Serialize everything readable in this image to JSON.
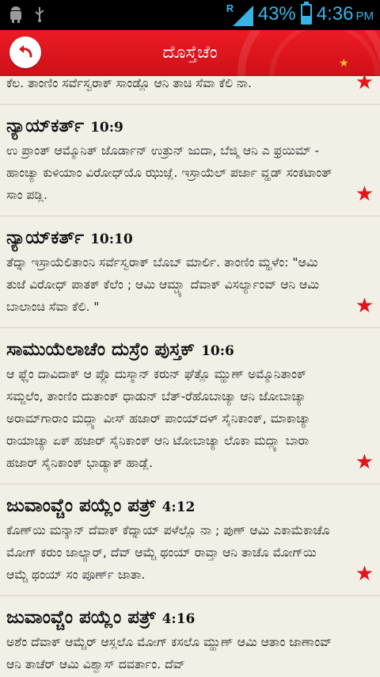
{
  "status_bar": {
    "icons": [
      "android-icon",
      "usb-icon"
    ],
    "network_type": "R",
    "battery_percent": "43%",
    "battery_level": 0.43,
    "time": "4:36",
    "time_suffix": "PM",
    "colors": {
      "background": "#000000",
      "accent": "#36b5e5"
    }
  },
  "app_bar": {
    "title": "ದೊಸ್ತೆಚೆಂ",
    "back_icon": "back-arrow-icon",
    "colors": {
      "background": "#e31b23",
      "text": "#ffffff"
    }
  },
  "verses": [
    {
      "book": "",
      "ref": "",
      "text": "ಕೆಲ. ತಾಂಣಿಂ ಸರ್ವೆಸ್ವರಾಕ್ ಸಾಂಡ್ಲೊ ಆನಿ ತಾಚಿ ಸೆವಾ ಕೆಲಿ ನಾ.",
      "starred": true
    },
    {
      "book": "ನ್ಯಾಯ್‌ಕರ್ತ್",
      "ref": "10:9",
      "text": "ಉ ಪ್ರಾಂತ್ ಆಮ್ಮೊನಿತ್ ಜೊರ್ಡಾನ್ ಉತ್ರುನ್ ಜುದಾ, ಬೆಜ್ಮಿ ಆನಿ ಎ ಫ್ರಯಿಮ್ - ಹಾಂಚ್ಯಾ ಕುಳಿಯಾಂ ವಿರೋಧ್‌ಯೊ ಝುಜ್ಲೆ. ಇಸ್ರಾಯೆಲ್ ಪರ್ಜಾ ವ್ಹಡ್ ಸಂಕಟಾಂತ್ ಸಾಂ ಪಡ್ಲಿ.",
      "starred": true
    },
    {
      "book": "ನ್ಯಾಯ್‌ಕರ್ತ್",
      "ref": "10:10",
      "text": "ತೆದ್ನಾ ಇಸ್ರಾಯೆಲಿತಾಂನಿ ಸರ್ವೆಸ್ವರಾಕ್ ಬೊಬ್ ಮಾರ್ಲಿ. ತಾಂಣಿಂ ಮ್ಹಳೆಂ: \"ಆಮಿ ತುಜೆ ವಿರೋಧ್ ಪಾತಕ್ ಕೆಲೆಂ ; ಆಮಿ ಆಮ್ಚ್ಯಾ ದೆವಾಕ್ ವಿಸರ್ಲ್ಯಾಂವ್ ಆನಿ ಆಮಿ ಬಾಲಾಂಚಿ ಸೆವಾ ಕೆಲಿ. \"",
      "starred": true
    },
    {
      "book": "ಸಾಮುಯೆಲಾಚೆಂ ದುಸ್ರೆಂ ಪುಸ್ತಕ್",
      "ref": "10:6",
      "text": "ಆ ಫ್ಣೆಂ ದಾವಿದಾಕ್ ಆ ಪ್ಲೊ ದುಸ್ಮಾನ್ ಕರುನ್ ಘೆತ್ಲೊ ಮ್ಹುಣ್ ಅಮ್ಮೊನಿತಾಂಕ್ ಸಮ್ಜಲೆಂ, ತಾಂಣಿಂ ದುತಾಂಕ್ ಧಾಡುನ್ ಬೆತ್-ರೆಹೊಬಾಚ್ಯಾ ಆನಿ ಜೋಬಾಚ್ಯಾ ಅರಾಮ್‌ಗಾರಾಂ ಮದ್ಲ್ಯಾ ವೀಸ್ ಹಜಾರ್ ಪಾಂಯ್‌ದಳ್ ಸೈನಿಕಾಂಕ್, ಮಾಕಾಚ್ಯಾ ರಾಯಾಚ್ಯಾ ಏಕ್ ಹಜಾರ್ ಸೈನಿಕಾಂಕ್ ಆನಿ ಟೋಬಾಚ್ಯಾ ಲೊಕಾ ಮದ್ಲ್ಯಾ ಬಾರಾ ಹಜಾರ್ ಸೈನಿಕಾಂಕ್ ಭಾಡ್ಯಾಕ್ ಹಾಡ್ಲೆ.",
      "starred": true
    },
    {
      "book": "ಜುವಾಂವ್ಚೆಂ ಪಯ್ಲೆಂ ಪತ್ರ್",
      "ref": "4:12",
      "text": "ಕೊಣ್‌ಯಿ ಮನ್ಶಾನ್ ದೆವಾಕ್ ಕೆದ್ನಾಯ್ ಪಳೆಲ್ಲೊ ನಾ ; ಪುಣ್ ಆಮಿ ಎಕಾಮೆಕಾಚೊ ಮೋಗ್ ಕರುಂ ಜಾಲ್ಯಾರ್, ದೆವ್ ಆಮ್ಚೆ ಥಂಯ್ ರಾವ್ತಾ ಆನಿ ತಾಚೊ ಮೋಗ್‌ಯಿ ಆಮ್ಚೆ ಥಂಯ್ ಸಂ ಪೂರ್ಣ್ ಜಾತಾ.",
      "starred": true
    },
    {
      "book": "ಜುವಾಂವ್ಚೆಂ ಪಯ್ಲೆಂ ಪತ್ರ್",
      "ref": "4:16",
      "text": "ಅಶೆಂ ದೆವಾಕ್ ಆಮ್ಚೆರ್ ಆಸ್ಲಲೊ ಮೋಗ್ ಕಸಲೊ ಮ್ಹುಣ್ ಆಮಿ ಆತಾಂ ಜಾಣಾಂವ್ ಆನಿ ತಾಚೆರ್ ಆಮಿ ವಿಶ್ವಾಸ್ ದವರ್ತಾಂ. ದೆವ್",
      "starred": false
    }
  ],
  "colors": {
    "page_background": "#f2efe6",
    "star": "#e3141a"
  }
}
